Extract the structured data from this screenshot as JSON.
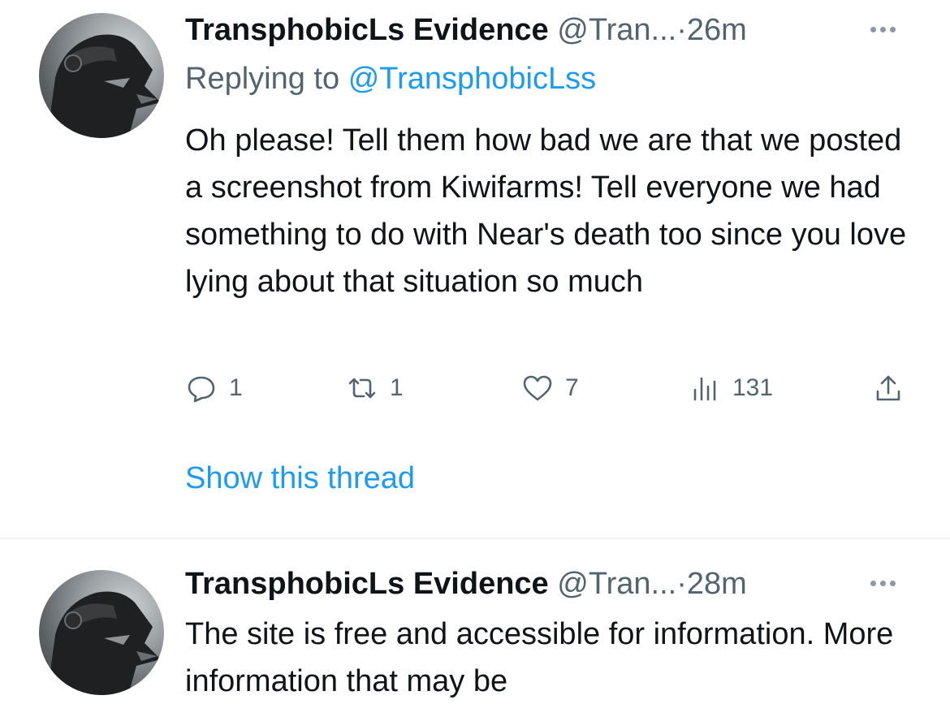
{
  "tweets": [
    {
      "name": "TransphobicLs Evidence",
      "handle": "@Tran...",
      "separator": "·",
      "time": "26m",
      "reply_prefix": "Replying to",
      "reply_to": "@TransphobicLss",
      "text": "Oh please! Tell them how bad we are that we posted a screenshot from Kiwifarms! Tell everyone we had something to do with Near's death too since you love lying about that situation so much",
      "replies": "1",
      "retweets": "1",
      "likes": "7",
      "views": "131",
      "show_thread": "Show this thread"
    },
    {
      "name": "TransphobicLs Evidence",
      "handle": "@Tran...",
      "separator": "·",
      "time": "28m",
      "text": "The site is free and accessible for information. More information that may be"
    }
  ],
  "icons": {
    "reply": "reply-icon",
    "retweet": "retweet-icon",
    "like": "heart-icon",
    "views": "views-icon",
    "share": "share-icon",
    "more": "more-icon"
  },
  "colors": {
    "link": "#1d9bf0",
    "secondary": "#536471",
    "text": "#0f1419"
  }
}
